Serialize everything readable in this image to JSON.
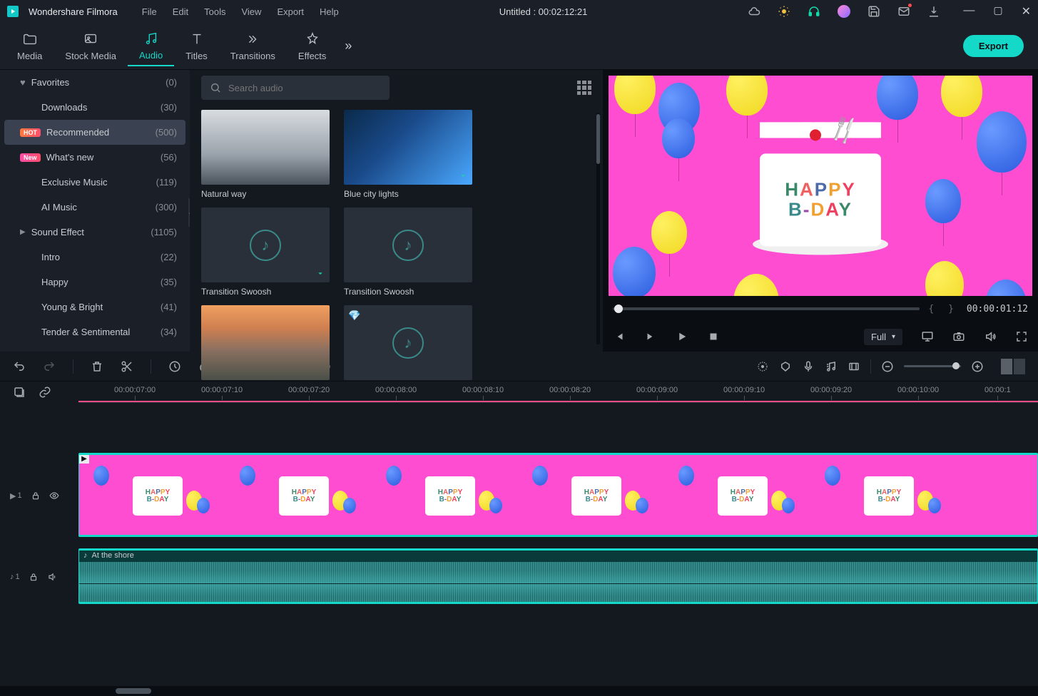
{
  "app_name": "Wondershare Filmora",
  "menu": [
    "File",
    "Edit",
    "Tools",
    "View",
    "Export",
    "Help"
  ],
  "document_title": "Untitled : 00:02:12:21",
  "tabs": [
    {
      "label": "Media"
    },
    {
      "label": "Stock Media"
    },
    {
      "label": "Audio",
      "active": true
    },
    {
      "label": "Titles"
    },
    {
      "label": "Transitions"
    },
    {
      "label": "Effects"
    }
  ],
  "export_label": "Export",
  "search_placeholder": "Search audio",
  "sidebar": [
    {
      "label": "Favorites",
      "count": "(0)",
      "icon": "heart"
    },
    {
      "label": "Downloads",
      "count": "(30)",
      "sub": true
    },
    {
      "label": "Recommended",
      "count": "(500)",
      "badge": "HOT",
      "highlight": true
    },
    {
      "label": "What's new",
      "count": "(56)",
      "badge": "New"
    },
    {
      "label": "Exclusive Music",
      "count": "(119)",
      "sub": true
    },
    {
      "label": "AI Music",
      "count": "(300)",
      "sub": true
    },
    {
      "label": "Sound Effect",
      "count": "(1105)",
      "caret": true
    },
    {
      "label": "Intro",
      "count": "(22)",
      "sub": true
    },
    {
      "label": "Happy",
      "count": "(35)",
      "sub": true
    },
    {
      "label": "Young & Bright",
      "count": "(41)",
      "sub": true
    },
    {
      "label": "Tender & Sentimental",
      "count": "(34)",
      "sub": true
    }
  ],
  "audio_items": [
    {
      "label": "Natural way",
      "thumb": "natural"
    },
    {
      "label": "Blue city lights",
      "thumb": "blue",
      "dl": true
    },
    {
      "label": "Transition Swoosh",
      "thumb": "note",
      "dl": true
    },
    {
      "label": "Transition Swoosh",
      "thumb": "note"
    },
    {
      "label": "",
      "thumb": "beach"
    },
    {
      "label": "",
      "thumb": "note",
      "diamond": true
    }
  ],
  "preview_timecode": "00:00:01:12",
  "quality": "Full",
  "cake_line1_chars": [
    "H",
    "A",
    "P",
    "P",
    "Y"
  ],
  "cake_line2_chars": [
    "B",
    "-",
    "D",
    "A",
    "Y"
  ],
  "ruler_ticks": [
    "00:00:07:00",
    "00:00:07:10",
    "00:00:07:20",
    "00:00:08:00",
    "00:00:08:10",
    "00:00:08:20",
    "00:00:09:00",
    "00:00:09:10",
    "00:00:09:20",
    "00:00:10:00",
    "00:00:1"
  ],
  "audio_clip_label": "At the shore",
  "video_track_label": "1",
  "audio_track_label": "1",
  "brackets": "{   }"
}
